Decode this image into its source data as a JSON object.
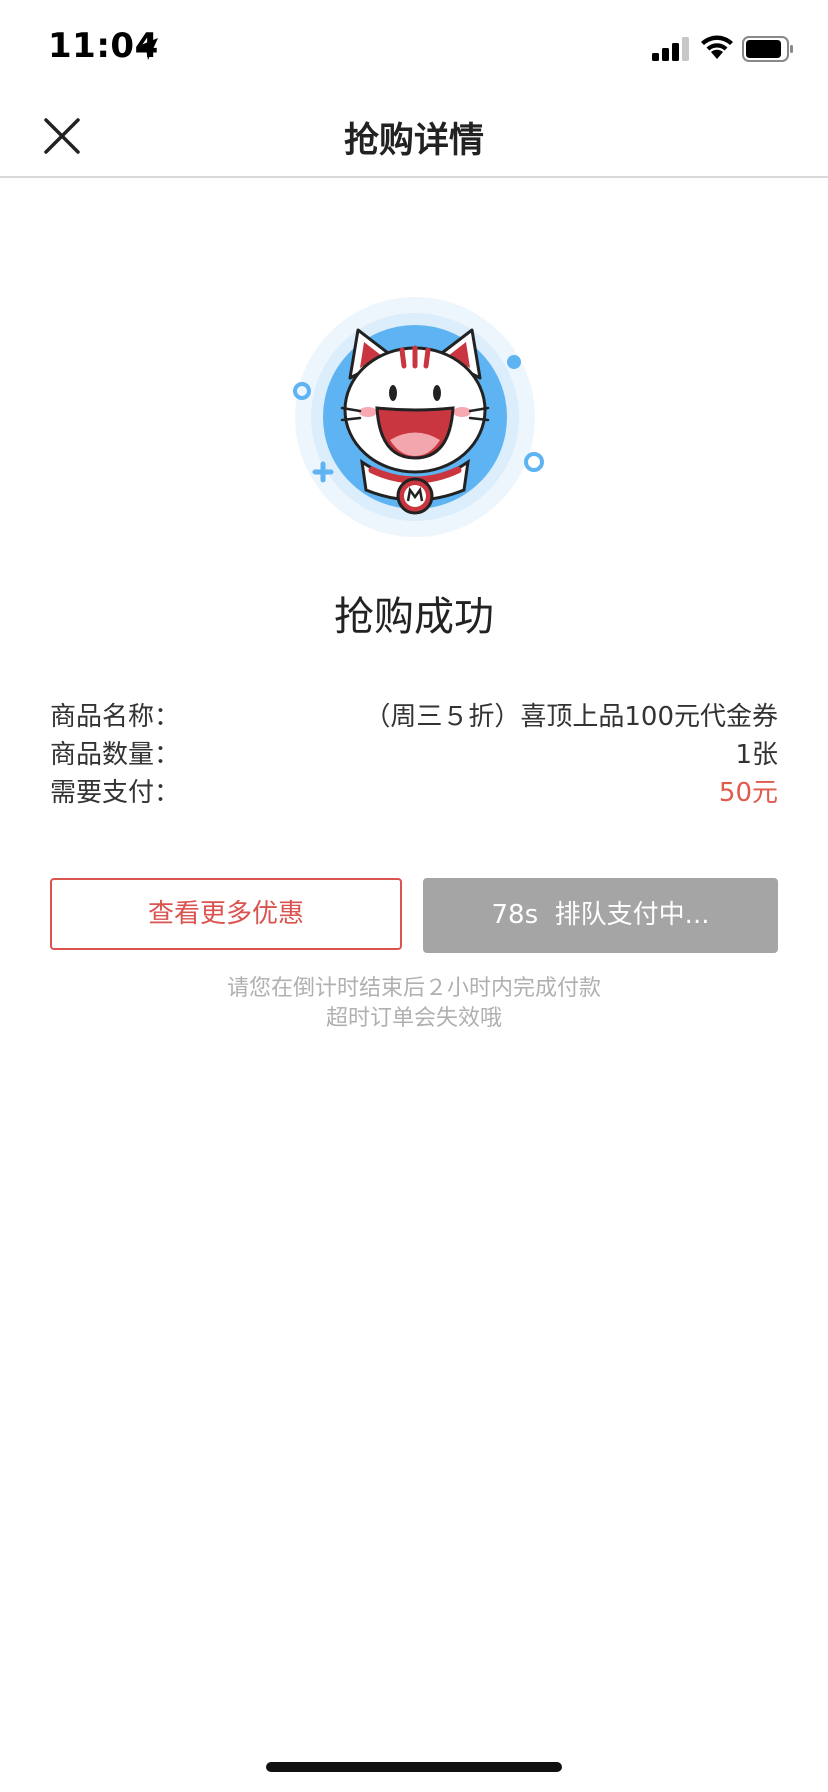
{
  "status_bar": {
    "time": "11:04",
    "icons": [
      "location-arrow-icon",
      "cellular-signal-icon",
      "wifi-icon",
      "battery-icon"
    ]
  },
  "nav": {
    "title": "抢购详情",
    "close_icon": "close-icon"
  },
  "result": {
    "mascot": "cat-mascot-illustration",
    "title": "抢购成功"
  },
  "details": [
    {
      "label": "商品名称：",
      "value": "（周三５折）喜顶上品100元代金券"
    },
    {
      "label": "商品数量：",
      "value": "1张"
    },
    {
      "label": "需要支付：",
      "value": "50元"
    }
  ],
  "buttons": {
    "more_offers": "查看更多优惠",
    "pay_status": "78s  排队支付中..."
  },
  "hint": {
    "line1": "请您在倒计时结束后２小时内完成付款",
    "line2": "超时订单会失效哦"
  },
  "colors": {
    "accent_red": "#d9534f",
    "price_red": "#e05a4e",
    "disabled_gray": "#a5a5a5",
    "mascot_blue": "#4aa8f0"
  }
}
